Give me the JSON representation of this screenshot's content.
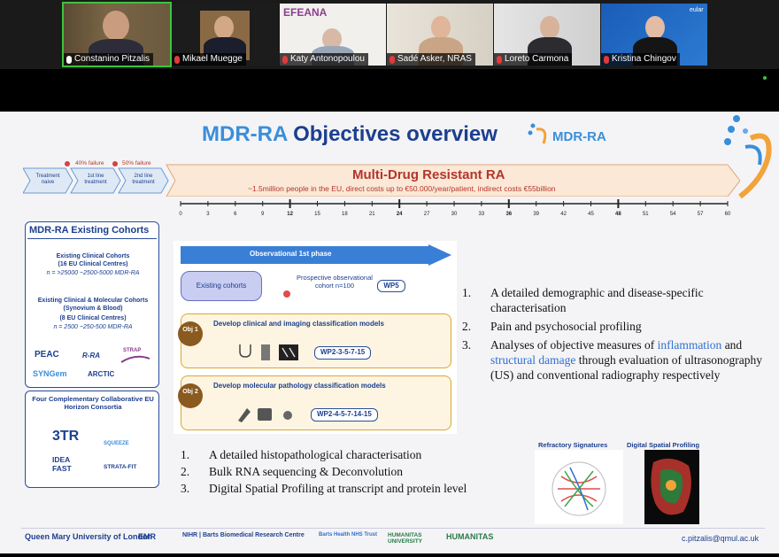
{
  "participants": [
    {
      "name": "Constanino Pitzalis",
      "muted": false,
      "active": true
    },
    {
      "name": "Mikael Muegge",
      "muted": true
    },
    {
      "name": "Katy Antonopoulou",
      "muted": true,
      "logo_text": "EFEANA"
    },
    {
      "name": "Sadé Asker, NRAS",
      "muted": true
    },
    {
      "name": "Loreto Carmona",
      "muted": true
    },
    {
      "name": "Kristina Chingov",
      "muted": true,
      "logo_text": "eular"
    }
  ],
  "slide": {
    "title_prefix": "MDR-RA",
    "title_rest": " Objectives overview",
    "title_logo": "MDR-RA",
    "pipeline": {
      "stages": [
        "Treatment naive",
        "1st line treatment",
        "2nd line treatment"
      ],
      "failure_1": "40% failure",
      "failure_2": "50% failure",
      "mdr_title": "Multi-Drug Resistant RA",
      "mdr_sub": "~1.5million people in the EU, direct costs up to €50.000/year/patient, indirect costs €55billion"
    },
    "timeline": {
      "ticks": [
        "0",
        "3",
        "6",
        "9",
        "12",
        "15",
        "18",
        "21",
        "24",
        "27",
        "30",
        "33",
        "36",
        "39",
        "42",
        "45",
        "48",
        "51",
        "54",
        "57",
        "60"
      ],
      "bold_ticks": [
        "12",
        "24",
        "36",
        "48"
      ]
    },
    "cohorts": {
      "title": "MDR-RA Existing Cohorts",
      "c1_title": "Existing Clinical Cohorts",
      "c1_sub": "(16 EU Clinical Centres)",
      "c1_n": "n = >25000 ~2500-5000 MDR-RA",
      "c2_title": "Existing Clinical & Molecular Cohorts (Synovium & Blood)",
      "c2_sub": "(8 EU Clinical Centres)",
      "c2_n": "n = 2500 ~250-500 MDR-RA",
      "logos": [
        "PEAC",
        "R-RA",
        "STRAP",
        "SYNGem",
        "ARCTIC"
      ]
    },
    "consortia": {
      "title": "Four Complementary Collaborative EU Horizon Consortia",
      "logos": [
        "3TR",
        "SQUEEZE",
        "IDEA FAST",
        "STRATA-FIT"
      ]
    },
    "phase": {
      "arrow_label": "Observational 1st phase",
      "existing": "Existing  cohorts",
      "prospective": "Prospective observational cohort n=100",
      "wp5": "WP5",
      "obj1_circle": "Obj 1",
      "obj1_title": "Develop clinical and imaging classification models",
      "obj1_wp": "WP2-3-5-7-15",
      "obj2_circle": "Obj 2",
      "obj2_title": "Develop molecular pathology classification models",
      "obj2_wp": "WP2-4-5-7-14-15"
    },
    "objectives": [
      {
        "num": "1.",
        "text": "A detailed demographic and disease-specific characterisation"
      },
      {
        "num": "2.",
        "text": "Pain and psychosocial profiling"
      },
      {
        "num": "3.",
        "text_a": "Analyses of objective measures of ",
        "hl_a": "inflammation",
        "text_b": " and ",
        "hl_b": "structural damage",
        "text_c": " through evaluation of ultrasonography (US) and conventional radiography respectively"
      }
    ],
    "molecular": [
      {
        "num": "1.",
        "text": "A detailed histopathological characterisation"
      },
      {
        "num": "2.",
        "text": "Bulk RNA sequencing & Deconvolution"
      },
      {
        "num": "3.",
        "text": "Digital Spatial Profiling at transcript and protein level"
      }
    ],
    "fig1_label": "Refractory Signatures",
    "fig2_label": "Digital Spatial Profiling",
    "footer": {
      "logos": [
        "Queen Mary University of London",
        "EMR",
        "NIHR | Barts Biomedical Research Centre",
        "Barts Health NHS Trust",
        "HUMANITAS UNIVERSITY",
        "HUMANITAS"
      ],
      "email": "c.pitzalis@qmul.ac.uk"
    }
  }
}
